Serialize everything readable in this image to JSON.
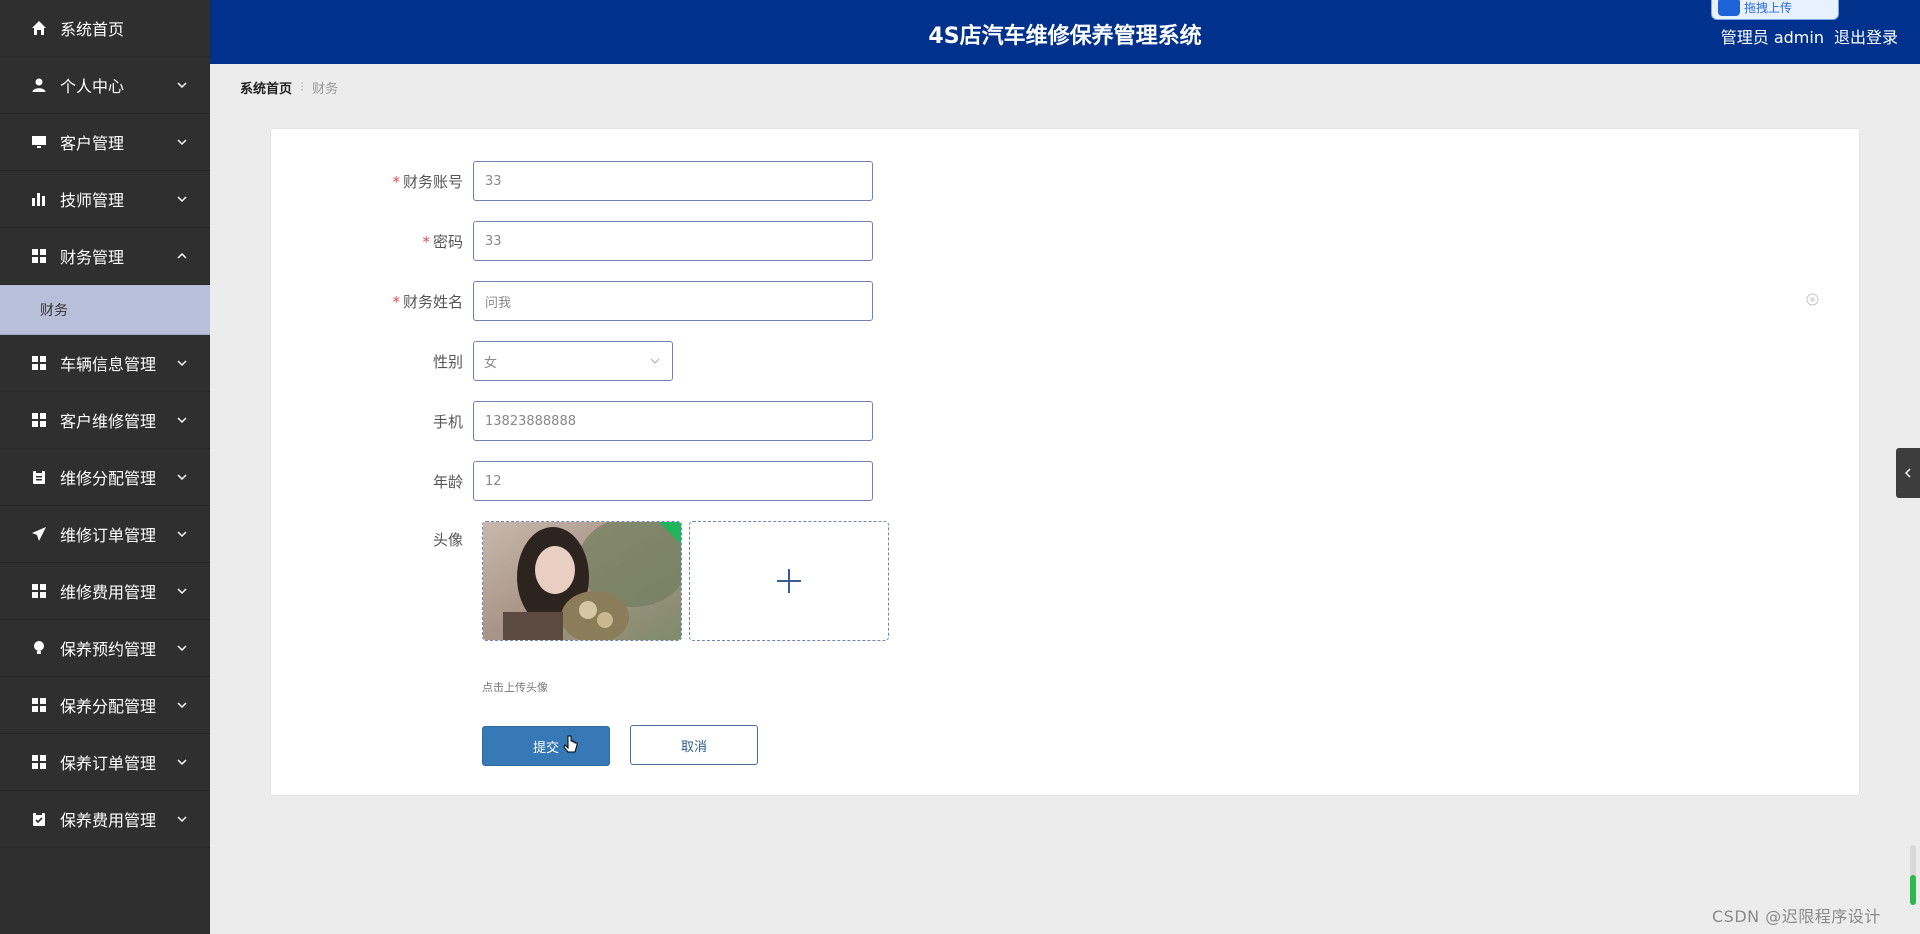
{
  "header": {
    "title": "4S店汽车维修保养管理系统",
    "user_label": "管理员 admin",
    "logout_label": "退出登录",
    "upload_chip_label": "拖拽上传",
    "bg_color": "#00318c"
  },
  "sidebar": {
    "items": [
      {
        "label": "系统首页",
        "icon": "home-icon"
      },
      {
        "label": "个人中心",
        "icon": "user-icon"
      },
      {
        "label": "客户管理",
        "icon": "monitor-icon"
      },
      {
        "label": "技师管理",
        "icon": "bar-chart-icon"
      },
      {
        "label": "财务管理",
        "icon": "grid-icon",
        "expanded": true
      },
      {
        "label": "车辆信息管理",
        "icon": "grid-icon"
      },
      {
        "label": "客户维修管理",
        "icon": "grid-icon"
      },
      {
        "label": "维修分配管理",
        "icon": "clipboard-icon"
      },
      {
        "label": "维修订单管理",
        "icon": "send-icon"
      },
      {
        "label": "维修费用管理",
        "icon": "grid-icon"
      },
      {
        "label": "保养预约管理",
        "icon": "bulb-icon"
      },
      {
        "label": "保养分配管理",
        "icon": "grid-icon"
      },
      {
        "label": "保养订单管理",
        "icon": "grid-icon"
      },
      {
        "label": "保养费用管理",
        "icon": "clipboard-check-icon"
      }
    ],
    "sub_item": {
      "label": "财务",
      "active": true
    },
    "active_color": "#b7bfd9"
  },
  "breadcrumb": {
    "home": "系统首页",
    "current": "财务"
  },
  "form": {
    "account": {
      "label": "财务账号",
      "value": "33",
      "required": true
    },
    "password": {
      "label": "密码",
      "value": "33",
      "required": true
    },
    "name": {
      "label": "财务姓名",
      "value": "问我",
      "required": true
    },
    "gender": {
      "label": "性别",
      "value": "女"
    },
    "phone": {
      "label": "手机",
      "value": "13823888888"
    },
    "age": {
      "label": "年龄",
      "value": "12"
    },
    "avatar": {
      "label": "头像",
      "hint": "点击上传头像"
    },
    "submit_label": "提交",
    "cancel_label": "取消"
  },
  "watermark": "CSDN @迟限程序设计"
}
